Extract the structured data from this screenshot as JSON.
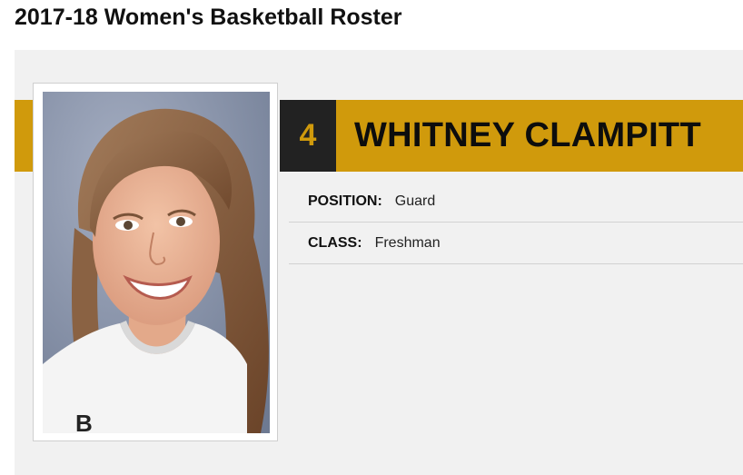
{
  "page": {
    "title": "2017-18 Women's Basketball Roster"
  },
  "player": {
    "number": "4",
    "name": "WHITNEY CLAMPITT",
    "position_label": "POSITION:",
    "position": "Guard",
    "class_label": "CLASS:",
    "class": "Freshman",
    "jersey_letter": "B"
  },
  "colors": {
    "accent_gold": "#d09a0c",
    "number_box": "#222222",
    "card_background": "#f1f1f1"
  }
}
